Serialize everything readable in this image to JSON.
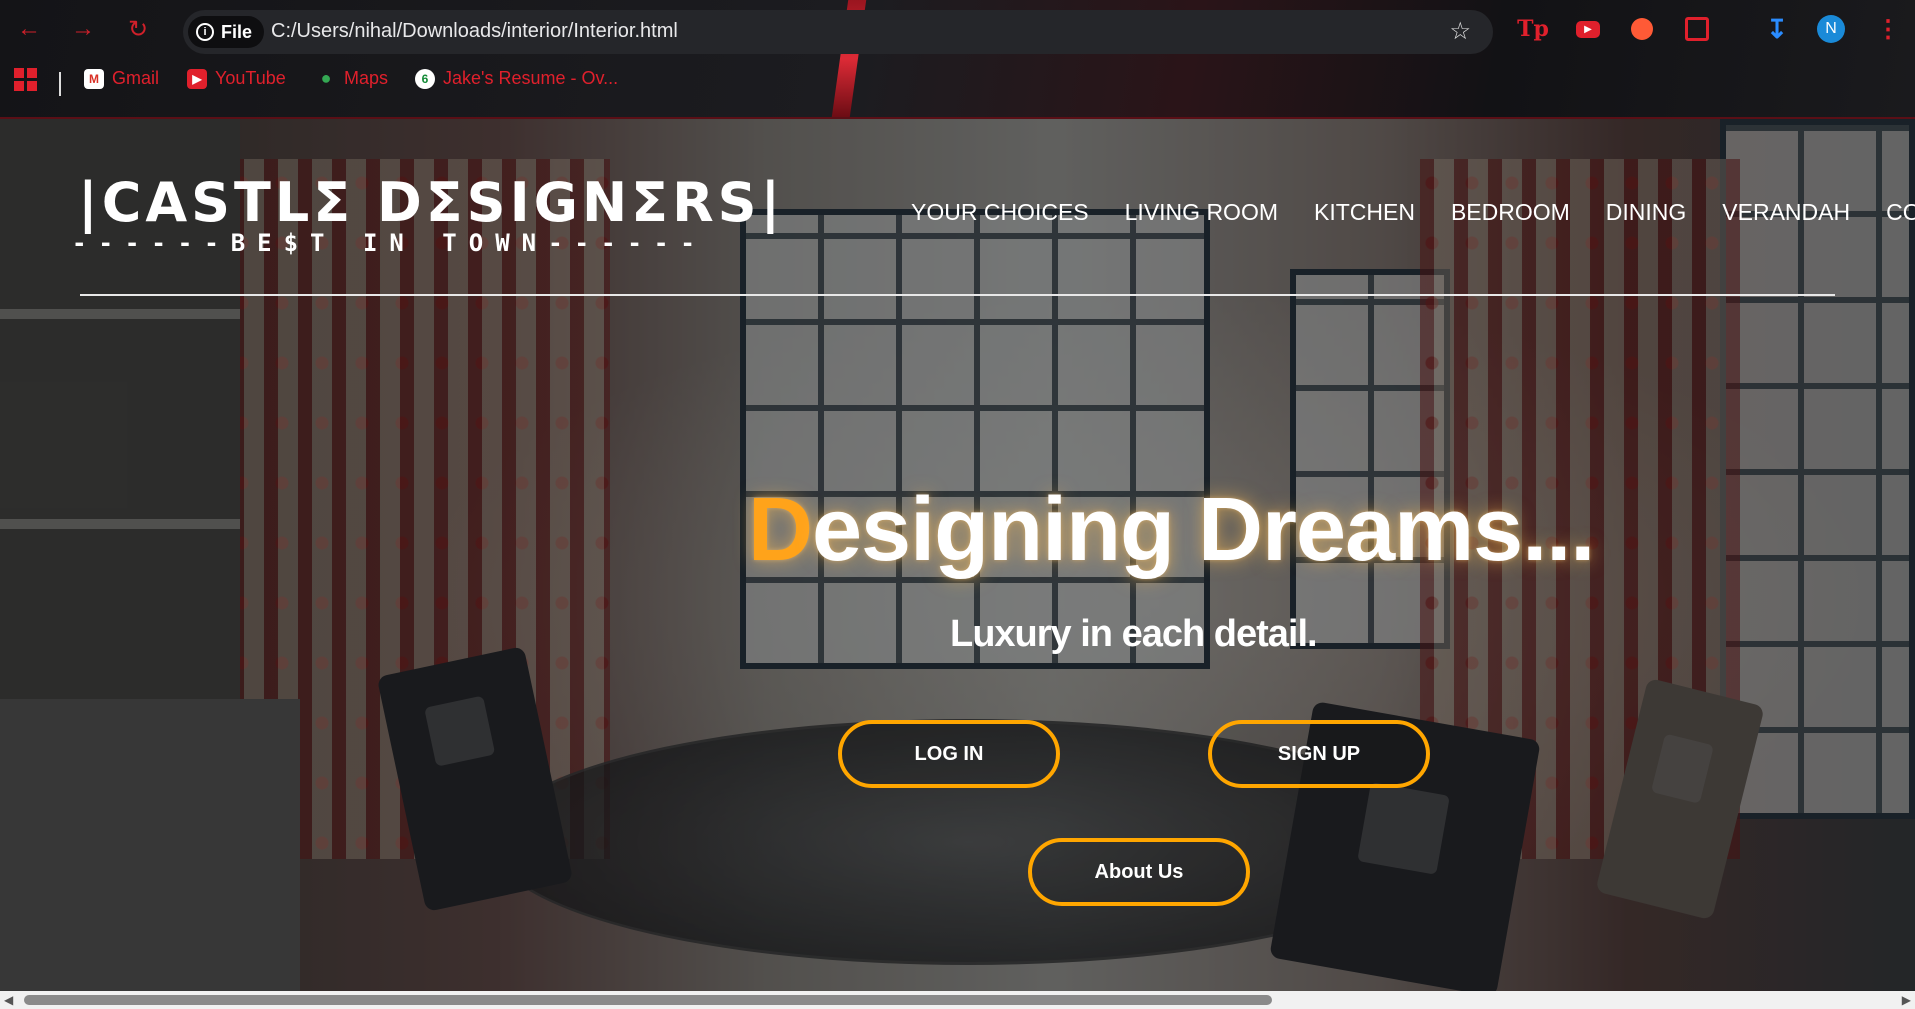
{
  "browser": {
    "site_chip_label": "File",
    "url": "C:/Users/nihal/Downloads/interior/Interior.html",
    "profile_initial": "N",
    "accent_color": "#e0202c",
    "bookmarks": [
      {
        "label": "Gmail",
        "icon": "gmail-icon"
      },
      {
        "label": "YouTube",
        "icon": "youtube-icon"
      },
      {
        "label": "Maps",
        "icon": "maps-icon"
      },
      {
        "label": "Jake's Resume - Ov...",
        "icon": "overleaf-icon"
      }
    ]
  },
  "site": {
    "logo": "|CASTLΣ DΣSIGNΣRS|",
    "tagline": "------BE$T IN TOWN------",
    "menu": [
      "YOUR CHOICES",
      "LIVING ROOM",
      "KITCHEN",
      "BEDROOM",
      "DINING",
      "VERANDAH",
      "CO"
    ],
    "hero_title_first": "D",
    "hero_title_rest": "esigning Dreams...",
    "hero_subtitle": "Luxury in each detail.",
    "buttons": {
      "login": "LOG IN",
      "signup": "SIGN UP",
      "about": "About Us"
    },
    "accent_color": "#ffa600"
  }
}
